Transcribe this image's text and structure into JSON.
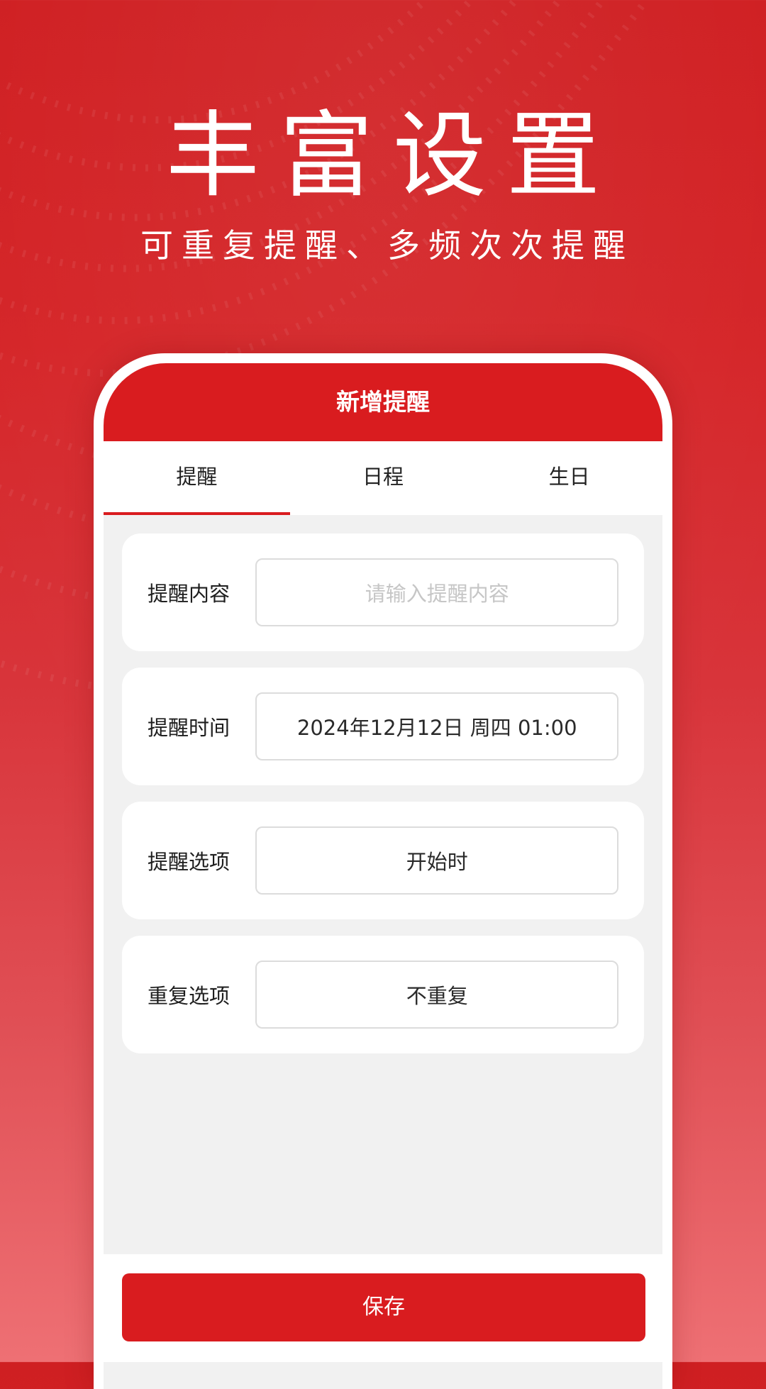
{
  "hero": {
    "title": "丰富设置",
    "subtitle": "可重复提醒、多频次次提醒"
  },
  "app": {
    "header_title": "新增提醒",
    "tabs": [
      {
        "label": "提醒",
        "active": true
      },
      {
        "label": "日程",
        "active": false
      },
      {
        "label": "生日",
        "active": false
      }
    ],
    "form": {
      "content": {
        "label": "提醒内容",
        "placeholder": "请输入提醒内容",
        "value": ""
      },
      "time": {
        "label": "提醒时间",
        "value": "2024年12月12日 周四 01:00"
      },
      "option": {
        "label": "提醒选项",
        "value": "开始时"
      },
      "repeat": {
        "label": "重复选项",
        "value": "不重复"
      }
    },
    "save_label": "保存"
  },
  "colors": {
    "brand_red": "#d91c1f",
    "panel_bg": "#f1f1f1"
  }
}
